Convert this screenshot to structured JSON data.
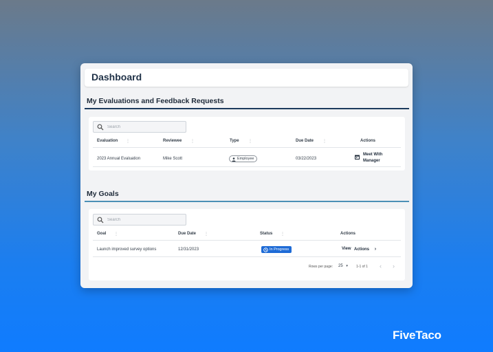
{
  "dashboard": {
    "title": "Dashboard"
  },
  "evaluations": {
    "title": "My Evaluations and Feedback Requests",
    "search_placeholder": "Search",
    "columns": [
      "Evaluation",
      "Reviewee",
      "Type",
      "Due Date",
      "Actions"
    ],
    "rows": [
      {
        "evaluation": "2023 Annual Evaluation",
        "reviewee": "Mike Scott",
        "type": "Employee",
        "due_date": "03/22/2023",
        "action_line1": "Meet With",
        "action_line2": "Manager"
      }
    ]
  },
  "goals": {
    "title": "My Goals",
    "search_placeholder": "Search",
    "columns": [
      "Goal",
      "Due Date",
      "Status",
      "Actions"
    ],
    "rows": [
      {
        "goal": "Launch improved survey options",
        "due_date": "12/31/2023",
        "status": "In Progress",
        "view_label": "View",
        "actions_label": "Actions"
      }
    ],
    "pagination": {
      "rows_per_page_label": "Rows per page:",
      "rows_per_page_value": "25",
      "range": "1-1 of 1"
    }
  },
  "brand": {
    "name": "FiveTaco"
  },
  "colors": {
    "eval_section_line": "#1c3a5c",
    "goals_section_line": "#4b8fb5",
    "status_badge": "#1e6bd6"
  }
}
